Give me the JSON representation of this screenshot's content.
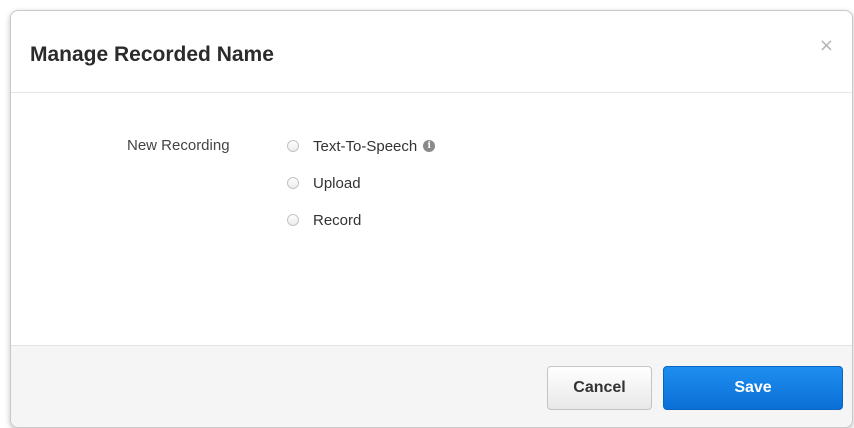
{
  "dialog": {
    "title": "Manage Recorded Name",
    "close_label": "×"
  },
  "form": {
    "field_label": "New Recording",
    "options": [
      {
        "label": "Text-To-Speech",
        "selected": false,
        "info_icon": "info-icon"
      },
      {
        "label": "Upload",
        "selected": false
      },
      {
        "label": "Record",
        "selected": false
      }
    ]
  },
  "footer": {
    "cancel_label": "Cancel",
    "save_label": "Save"
  },
  "colors": {
    "primary": "#0a6fd6",
    "footer_bg": "#f5f5f5"
  }
}
